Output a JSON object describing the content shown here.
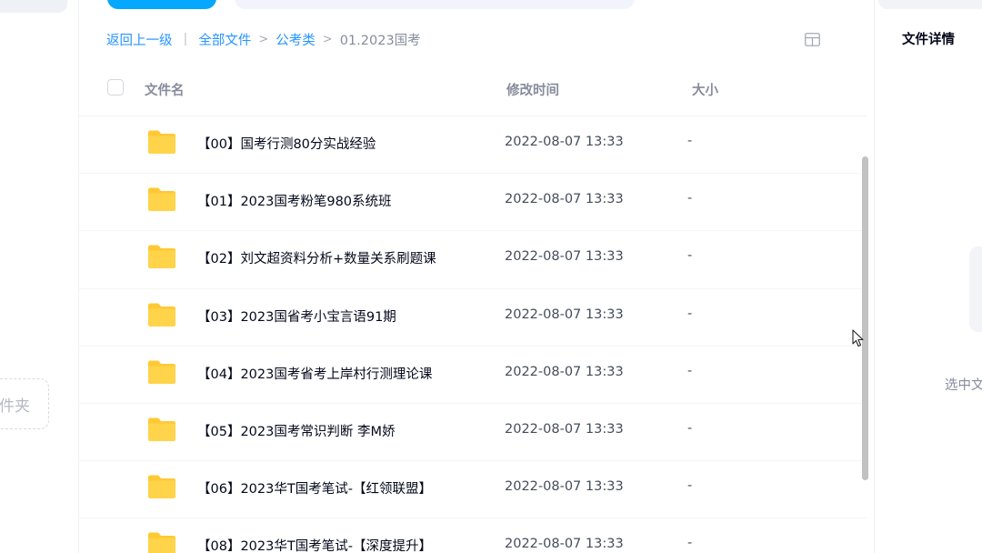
{
  "left": {
    "new_folder_partial": "件夹"
  },
  "breadcrumb": {
    "back": "返回上一级",
    "sep": "|",
    "all_files": "全部文件",
    "arrow": ">",
    "category": "公考类",
    "current": "01.2023国考"
  },
  "table": {
    "headers": {
      "name": "文件名",
      "time": "修改时间",
      "size": "大小"
    },
    "rows": [
      {
        "name": "【00】国考行测80分实战经验",
        "time": "2022-08-07 13:33",
        "size": "-"
      },
      {
        "name": "【01】2023国考粉笔980系统班",
        "time": "2022-08-07 13:33",
        "size": "-"
      },
      {
        "name": "【02】刘文超资料分析+数量关系刷题课",
        "time": "2022-08-07 13:33",
        "size": "-"
      },
      {
        "name": "【03】2023国省考小宝言语91期",
        "time": "2022-08-07 13:33",
        "size": "-"
      },
      {
        "name": "【04】2023国考省考上岸村行测理论课",
        "time": "2022-08-07 13:33",
        "size": "-"
      },
      {
        "name": "【05】2023国考常识判断 李M娇",
        "time": "2022-08-07 13:33",
        "size": "-"
      },
      {
        "name": "【06】2023华T国考笔试-【红领联盟】",
        "time": "2022-08-07 13:33",
        "size": "-"
      },
      {
        "name": "【08】2023华T国考笔试-【深度提升】",
        "time": "2022-08-07 13:33",
        "size": "-"
      }
    ]
  },
  "detail": {
    "title": "文件详情",
    "hint_partial": "选中文"
  },
  "colors": {
    "accent": "#06a7ff",
    "link": "#2695ff",
    "folder": "#ffc933",
    "muted": "#878c9c"
  },
  "icons": {
    "folder": "folder-icon",
    "view": "grid-view-icon",
    "cursor": "mouse-cursor-icon"
  }
}
